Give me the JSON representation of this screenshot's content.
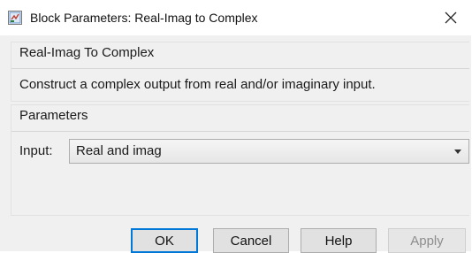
{
  "window": {
    "title": "Block Parameters: Real-Imag to Complex",
    "app_icon": "simulink-block-icon",
    "close_icon": "close-icon"
  },
  "block": {
    "name": "Real-Imag To Complex",
    "description": "Construct a complex output from real and/or imaginary input."
  },
  "parameters": {
    "heading": "Parameters",
    "input_label": "Input:",
    "input_value": "Real and imag"
  },
  "buttons": {
    "ok": "OK",
    "cancel": "Cancel",
    "help": "Help",
    "apply": "Apply"
  },
  "colors": {
    "focus_border": "#0078d7",
    "disabled_text": "#8d8d8d"
  }
}
